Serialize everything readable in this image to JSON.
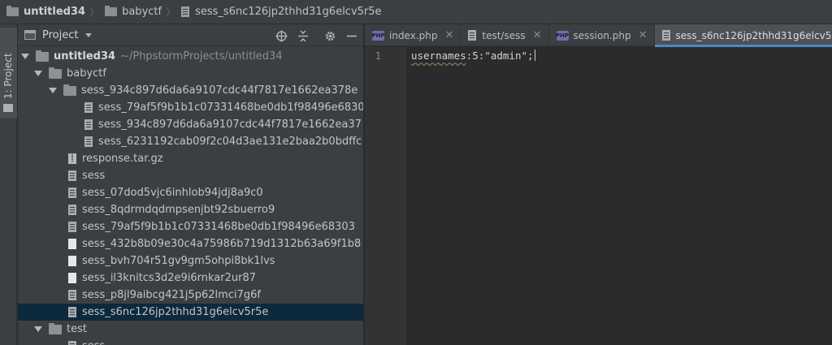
{
  "breadcrumb": [
    {
      "label": "untitled34",
      "type": "folder",
      "bold": true
    },
    {
      "label": "babyctf",
      "type": "folder",
      "bold": false
    },
    {
      "label": "sess_s6nc126jp2thhd31g6elcv5r5e",
      "type": "file",
      "bold": false
    }
  ],
  "toolstrip": {
    "project_label": "1: Project"
  },
  "panel": {
    "title": "Project",
    "buttons": [
      "locate-icon",
      "collapse-icon",
      "gear-icon",
      "minimize-icon"
    ]
  },
  "tree": {
    "root": {
      "label": "untitled34",
      "path": "~/PhpstormProjects/untitled34"
    },
    "rows": [
      {
        "label": "babyctf",
        "kind": "folder"
      },
      {
        "label": "sess_934c897d6da6a9107cdc44f7817e1662ea378e",
        "kind": "folder"
      },
      {
        "label": "sess_79af5f9b1b1c07331468be0db1f98496e6830",
        "kind": "file-lines"
      },
      {
        "label": "sess_934c897d6da6a9107cdc44f7817e1662ea37",
        "kind": "file-lines"
      },
      {
        "label": "sess_6231192cab09f2c04d3ae131e2baa2b0bdffc",
        "kind": "file-lines"
      },
      {
        "label": "response.tar.gz",
        "kind": "archive"
      },
      {
        "label": "sess",
        "kind": "file-lines"
      },
      {
        "label": "sess_07dod5vjc6inhlob94jdj8a9c0",
        "kind": "file-lines"
      },
      {
        "label": "sess_8qdrmdqdmpsenjbt92sbuerro9",
        "kind": "file-lines"
      },
      {
        "label": "sess_79af5f9b1b1c07331468be0db1f98496e68303",
        "kind": "file-lines"
      },
      {
        "label": "sess_432b8b09e30c4a75986b719d1312b63a69f1b8",
        "kind": "file-plain"
      },
      {
        "label": "sess_bvh704r51gv9gm5ohpi8bk1lvs",
        "kind": "file-plain"
      },
      {
        "label": "sess_il3knitcs3d2e9i6rnkar2ur87",
        "kind": "file-plain"
      },
      {
        "label": "sess_p8jl9aibcg421j5p62lmci7g6f",
        "kind": "file-lines"
      },
      {
        "label": "sess_s6nc126jp2thhd31g6elcv5r5e",
        "kind": "file-lines",
        "selected": true
      },
      {
        "label": "test",
        "kind": "folder"
      },
      {
        "label": "sess",
        "kind": "file-lines"
      }
    ]
  },
  "tabs": [
    {
      "label": "index.php",
      "icon": "php-icon",
      "active": false
    },
    {
      "label": "test/sess",
      "icon": "file-icon",
      "active": false
    },
    {
      "label": "session.php",
      "icon": "php-icon",
      "active": false
    },
    {
      "label": "sess_s6nc126jp2thhd31g6elcv5r5e",
      "icon": "file-icon",
      "active": true
    }
  ],
  "editor": {
    "line_number": "1",
    "code_word": "usernames",
    "code_rest": ":5:\"admin\";"
  },
  "colors": {
    "accent": "#4a88c7",
    "selection": "#0d293e",
    "php_icon": "#6d6ea9"
  }
}
